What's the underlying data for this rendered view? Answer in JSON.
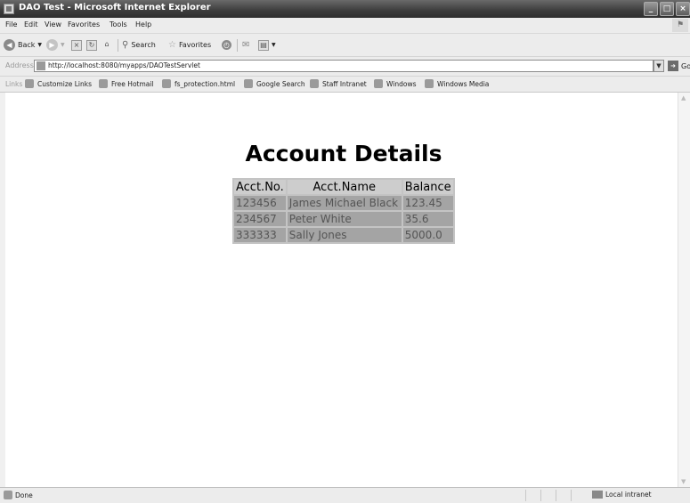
{
  "window": {
    "title": "DAO Test - Microsoft Internet Explorer",
    "controls": [
      "_",
      "□",
      "×"
    ]
  },
  "menu": [
    "File",
    "Edit",
    "View",
    "Favorites",
    "Tools",
    "Help"
  ],
  "toolbar": {
    "back": "Back",
    "search": "Search",
    "favorites": "Favorites"
  },
  "address": {
    "label": "Address",
    "url": "http://localhost:8080/myapps/DAOTestServlet",
    "go": "Go"
  },
  "links": {
    "label": "Links",
    "items": [
      "Customize Links",
      "Free Hotmail",
      "fs_protection.html",
      "Google Search",
      "Staff Intranet",
      "Windows",
      "Windows Media"
    ]
  },
  "page": {
    "heading": "Account Details",
    "table": {
      "headers": [
        "Acct.No.",
        "Acct.Name",
        "Balance"
      ],
      "rows": [
        [
          "123456",
          "James Michael Black",
          "123.45"
        ],
        [
          "234567",
          "Peter White",
          "35.6"
        ],
        [
          "333333",
          "Sally Jones",
          "5000.0"
        ]
      ]
    }
  },
  "status": {
    "text": "Done",
    "zone": "Local intranet"
  }
}
